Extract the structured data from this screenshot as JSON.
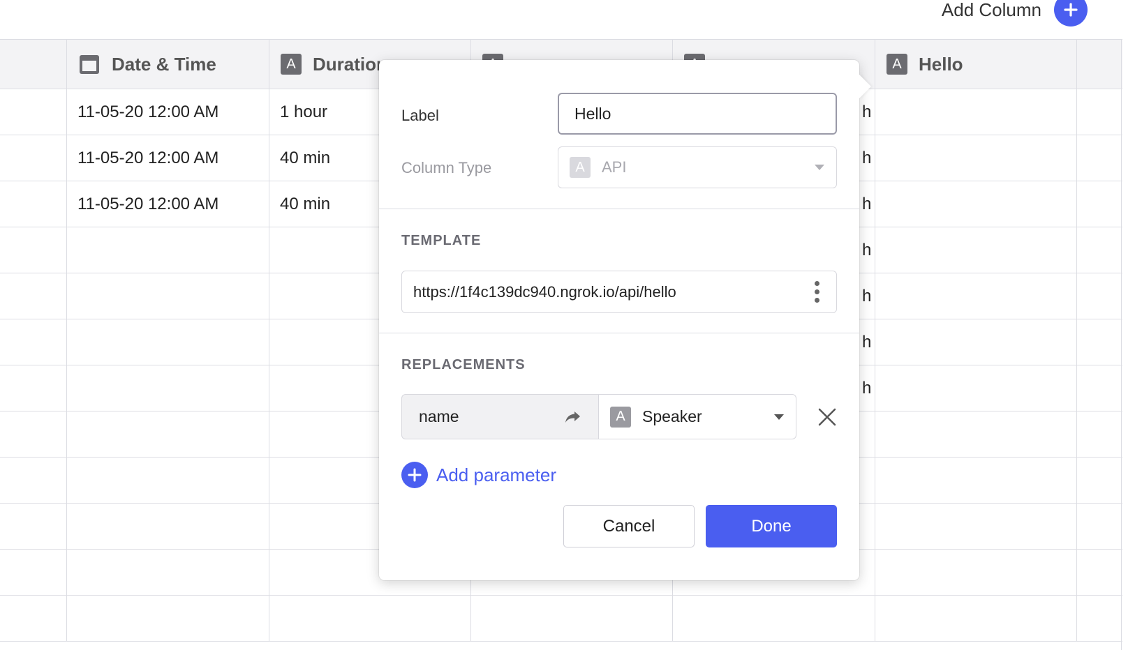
{
  "top_bar": {
    "add_column_label": "Add Column"
  },
  "grid": {
    "columns": [
      {
        "label": "",
        "icon": "none"
      },
      {
        "label": "Date & Time",
        "icon": "calendar-icon"
      },
      {
        "label": "Duration",
        "icon": "text-type-icon"
      },
      {
        "label": "",
        "icon": "text-type-icon"
      },
      {
        "label": "",
        "icon": "text-type-icon"
      },
      {
        "label": "Hello",
        "icon": "text-type-icon"
      }
    ],
    "rows": [
      {
        "date": "11-05-20 12:00 AM",
        "duration": "1 hour",
        "partial": "h"
      },
      {
        "date": "11-05-20 12:00 AM",
        "duration": "40 min",
        "partial": "h"
      },
      {
        "date": "11-05-20 12:00 AM",
        "duration": "40 min",
        "partial": "h"
      },
      {
        "date": "",
        "duration": "",
        "partial": "h"
      },
      {
        "date": "",
        "duration": "",
        "partial": "h"
      },
      {
        "date": "",
        "duration": "",
        "partial": "h"
      },
      {
        "date": "",
        "duration": "",
        "partial": "h"
      },
      {
        "date": "",
        "duration": "",
        "partial": ""
      },
      {
        "date": "",
        "duration": "",
        "partial": ""
      },
      {
        "date": "",
        "duration": "",
        "partial": ""
      },
      {
        "date": "",
        "duration": "",
        "partial": ""
      },
      {
        "date": "",
        "duration": "",
        "partial": ""
      }
    ]
  },
  "popover": {
    "label_field": {
      "label": "Label",
      "value": "Hello"
    },
    "column_type": {
      "label": "Column Type",
      "type_badge": "A",
      "value": "API"
    },
    "template": {
      "title": "TEMPLATE",
      "value": "https://1f4c139dc940.ngrok.io/api/hello"
    },
    "replacements": {
      "title": "REPLACEMENTS",
      "items": [
        {
          "name": "name",
          "type_badge": "A",
          "value": "Speaker"
        }
      ]
    },
    "add_parameter_label": "Add parameter",
    "cancel_label": "Cancel",
    "done_label": "Done"
  },
  "colors": {
    "accent": "#4a5ef0",
    "grid_border": "#dcdde3",
    "header_bg": "#f3f3f5"
  }
}
